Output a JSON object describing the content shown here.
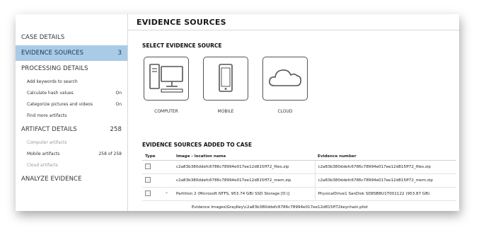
{
  "page": {
    "title": "EVIDENCE SOURCES"
  },
  "sidebar": {
    "case_details": "CASE DETAILS",
    "evidence_sources": {
      "label": "EVIDENCE SOURCES",
      "count": "3"
    },
    "processing_details": "PROCESSING DETAILS",
    "processing_items": [
      {
        "label": "Add keywords to search",
        "value": ""
      },
      {
        "label": "Calculate hash values",
        "value": "On"
      },
      {
        "label": "Categorize pictures and videos",
        "value": "On"
      },
      {
        "label": "Find more artifacts",
        "value": ""
      }
    ],
    "artifact_details": {
      "label": "ARTIFACT DETAILS",
      "count": "258"
    },
    "artifact_items": [
      {
        "label": "Computer artifacts",
        "value": ""
      },
      {
        "label": "Mobile artifacts",
        "value": "258 of 258"
      },
      {
        "label": "Cloud artifacts",
        "value": ""
      }
    ],
    "analyze_evidence": "ANALYZE EVIDENCE"
  },
  "select_section": {
    "title": "SELECT EVIDENCE SOURCE",
    "sources": [
      {
        "label": "COMPUTER",
        "icon": "computer-icon"
      },
      {
        "label": "MOBILE",
        "icon": "mobile-icon"
      },
      {
        "label": "CLOUD",
        "icon": "cloud-icon"
      }
    ]
  },
  "added_section": {
    "title": "EVIDENCE SOURCES ADDED TO CASE",
    "columns": {
      "type": "Type",
      "image": "Image - location name",
      "evidence": "Evidence number"
    },
    "rows": [
      {
        "image": "c2a83b380ddefc6786c78994e017ee12d815ff72_files.zip",
        "evidence": "c2a83b380ddefc6786c78994e017ee12d815ff72_files.zip"
      },
      {
        "image": "c2a83b380ddefc6786c78994e017ee12d815ff72_mem.zip",
        "evidence": "c2a83b380ddefc6786c78994e017ee12d815ff72_mem.zip"
      },
      {
        "image": "Partition 2 (Microsoft NTFS, 953.74 GB) SSD Storage [D:\\]",
        "evidence": "PhysicalDrive1 SanDisk SD8SB8U1T001122 (953.87 GB)"
      }
    ],
    "sub_row": "Evidence Images\\GrayKey\\c2a83b380ddefc6786c78994e017ee12d815ff72keychain.plist"
  }
}
